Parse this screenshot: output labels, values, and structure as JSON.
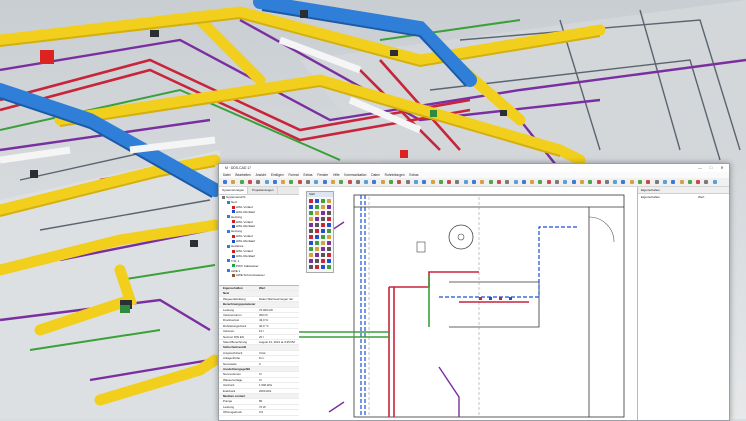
{
  "window": {
    "title": "M · DDS-CAD 17",
    "min_glyph": "—",
    "max_glyph": "□",
    "close_glyph": "✕"
  },
  "menu": [
    "Datei",
    "Bearbeiten",
    "Ansicht",
    "Einfügen",
    "Format",
    "Extras",
    "Fenster",
    "Hilfe",
    "Kommunikation",
    "Daten",
    "Rohrleitungen",
    "Extras"
  ],
  "left_panel": {
    "tabs": [
      "Systemanzeigen",
      "Projektanzeigen"
    ],
    "tree": [
      {
        "label": "Systemansicht",
        "indent": 0,
        "color": "#777777"
      },
      {
        "label": "Netz",
        "indent": 1,
        "color": "#2a7de1"
      },
      {
        "label": "HWL Vorlauf",
        "indent": 2,
        "color": "#d11f1f"
      },
      {
        "label": "HWL Rücklauf",
        "indent": 2,
        "color": "#1f4fd1"
      },
      {
        "label": "Heizung",
        "indent": 1,
        "color": "#2a7de1"
      },
      {
        "label": "HWL Vorlauf",
        "indent": 2,
        "color": "#d11f1f"
      },
      {
        "label": "HWL Rücklauf",
        "indent": 2,
        "color": "#1f4fd1"
      },
      {
        "label": "Heizung",
        "indent": 1,
        "color": "#2a7de1"
      },
      {
        "label": "HWL Vorlauf",
        "indent": 2,
        "color": "#d11f1f"
      },
      {
        "label": "HWL Rücklauf",
        "indent": 2,
        "color": "#1f4fd1"
      },
      {
        "label": "Heizkreis",
        "indent": 1,
        "color": "#2a7de1"
      },
      {
        "label": "HWL Vorlauf",
        "indent": 2,
        "color": "#d11f1f"
      },
      {
        "label": "HWL Rücklauf",
        "indent": 2,
        "color": "#1f4fd1"
      },
      {
        "label": "T.W. 1",
        "indent": 1,
        "color": "#2a7de1"
      },
      {
        "label": "PWC Kaltwasser",
        "indent": 2,
        "color": "#1aa64a"
      },
      {
        "label": "AWE 1",
        "indent": 1,
        "color": "#2a7de1"
      },
      {
        "label": "AWE Schmutzwasser",
        "indent": 2,
        "color": "#8a5a2b"
      }
    ]
  },
  "properties": [
    {
      "k": "Eigenschaften",
      "v": "Wert",
      "sec": true
    },
    {
      "k": "Netz",
      "v": "",
      "sec": true
    },
    {
      "k": "Wegeentwicklung",
      "v": "Daten Wärmeerzeuger der",
      "sec": false
    },
    {
      "k": "Berechnungsparameter",
      "v": "",
      "sec": true
    },
    {
      "k": "Leistung",
      "v": "70.000 kW",
      "sec": false
    },
    {
      "k": "Volumenstrom",
      "v": "300 l/h",
      "sec": false
    },
    {
      "k": "Druckverlust",
      "v": "43,0 %",
      "sec": false
    },
    {
      "k": "Rohrleitungsdruck",
      "v": "40,0 °C",
      "sec": false
    },
    {
      "k": "Volumen",
      "v": "10 l",
      "sec": false
    },
    {
      "k": "Normen DIN EN",
      "v": "20 l",
      "sec": false
    },
    {
      "k": "Stand Berechnung",
      "v": "August 31, 2021 at 3:35 PM",
      "sec": false
    },
    {
      "k": "Sicherheitsventil",
      "v": "",
      "sec": true
    },
    {
      "k": "Ansprechdruck",
      "v": "3 bar",
      "sec": false
    },
    {
      "k": "Anlagenhöhe",
      "v": "8 m",
      "sec": false
    },
    {
      "k": "Nennweite",
      "v": "0",
      "sec": false
    },
    {
      "k": "Ausdehnungsgefäß",
      "v": "",
      "sec": true
    },
    {
      "k": "Nennvolumen",
      "v": "0 l",
      "sec": false
    },
    {
      "k": "Wasservorlage",
      "v": "0 l",
      "sec": false
    },
    {
      "k": "Vordruck",
      "v": "1,500 kPa",
      "sec": false
    },
    {
      "k": "Enddruck",
      "v": "2000 kPa",
      "sec": false
    },
    {
      "k": "Medium content",
      "v": "",
      "sec": true
    },
    {
      "k": "Pumpe",
      "v": "80",
      "sec": false
    },
    {
      "k": "Leistung",
      "v": "70 W",
      "sec": false
    },
    {
      "k": "Öffnungsdruck",
      "v": "0,5",
      "sec": false
    }
  ],
  "palette": {
    "title": "SHK"
  },
  "right_panel": {
    "header": "Eigenschaften",
    "col1": "Eigenschaften",
    "col2": "Wert"
  },
  "colors": {
    "duct_yellow": "#f2cf1d",
    "duct_blue": "#2f7fd8",
    "pipe_red": "#c8243a",
    "pipe_purple": "#7a2fa0",
    "pipe_green": "#3aa03a",
    "pipe_gray": "#5b6470"
  }
}
